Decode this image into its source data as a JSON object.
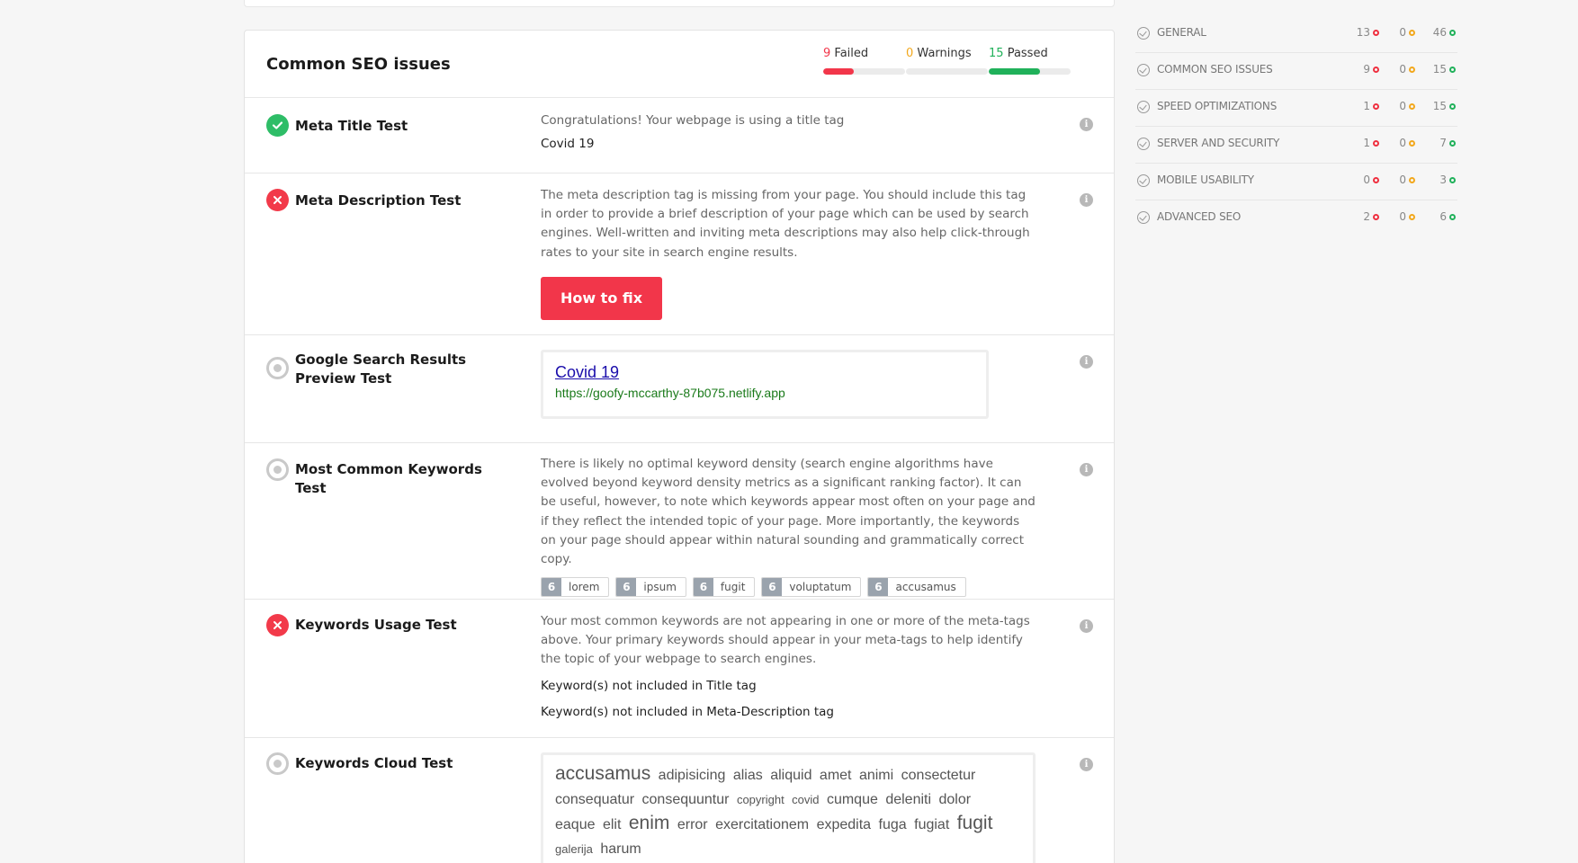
{
  "section": {
    "title": "Common SEO issues",
    "stats": {
      "failed": {
        "count": "9",
        "label": "Failed",
        "fraction": 0.375,
        "color": "#f2364a"
      },
      "warnings": {
        "count": "0",
        "label": "Warnings",
        "fraction": 0,
        "color": "#f2a81d"
      },
      "passed": {
        "count": "15",
        "label": "Passed",
        "fraction": 0.625,
        "color": "#20b15a"
      }
    }
  },
  "tests": {
    "meta_title": {
      "name": "Meta Title Test",
      "status": "pass",
      "description": "Congratulations! Your webpage is using a title tag",
      "value": "Covid 19"
    },
    "meta_description": {
      "name": "Meta Description Test",
      "status": "fail",
      "description": "The meta description tag is missing from your page. You should include this tag in order to provide a brief description of your page which can be used by search engines. Well-written and inviting meta descriptions may also help click-through rates to your site in search engine results.",
      "button": "How to fix"
    },
    "google_preview": {
      "name": "Google Search Results Preview Test",
      "status": "info",
      "serp_title": "Covid 19",
      "serp_url": "https://goofy-mccarthy-87b075.netlify.app"
    },
    "common_keywords": {
      "name": "Most Common Keywords Test",
      "status": "info",
      "description": "There is likely no optimal keyword density (search engine algorithms have evolved beyond keyword density metrics as a significant ranking factor). It can be useful, however, to note which keywords appear most often on your page and if they reflect the intended topic of your page. More importantly, the keywords on your page should appear within natural sounding and grammatically correct copy.",
      "keywords": [
        {
          "count": "6",
          "word": "lorem"
        },
        {
          "count": "6",
          "word": "ipsum"
        },
        {
          "count": "6",
          "word": "fugit"
        },
        {
          "count": "6",
          "word": "voluptatum"
        },
        {
          "count": "6",
          "word": "accusamus"
        }
      ]
    },
    "keywords_usage": {
      "name": "Keywords Usage Test",
      "status": "fail",
      "description": "Your most common keywords are not appearing in one or more of the meta-tags above. Your primary keywords should appear in your meta-tags to help identify the topic of your webpage to search engines.",
      "line1": "Keyword(s) not included in Title tag",
      "line2": "Keyword(s) not included in Meta-Description tag"
    },
    "keywords_cloud": {
      "name": "Keywords Cloud Test",
      "status": "info",
      "words": [
        {
          "word": "accusamus",
          "weight": 3
        },
        {
          "word": "adipisicing",
          "weight": 2
        },
        {
          "word": "alias",
          "weight": 2
        },
        {
          "word": "aliquid",
          "weight": 2
        },
        {
          "word": "amet",
          "weight": 2
        },
        {
          "word": "animi",
          "weight": 2
        },
        {
          "word": "consectetur",
          "weight": 2
        },
        {
          "word": "consequatur",
          "weight": 2
        },
        {
          "word": "consequuntur",
          "weight": 2
        },
        {
          "word": "copyright",
          "weight": 1
        },
        {
          "word": "covid",
          "weight": 1
        },
        {
          "word": "cumque",
          "weight": 2
        },
        {
          "word": "deleniti",
          "weight": 2
        },
        {
          "word": "dolor",
          "weight": 2
        },
        {
          "word": "eaque",
          "weight": 2
        },
        {
          "word": "elit",
          "weight": 2
        },
        {
          "word": "enim",
          "weight": 3
        },
        {
          "word": "error",
          "weight": 2
        },
        {
          "word": "exercitationem",
          "weight": 2
        },
        {
          "word": "expedita",
          "weight": 2
        },
        {
          "word": "fuga",
          "weight": 2
        },
        {
          "word": "fugiat",
          "weight": 2
        },
        {
          "word": "fugit",
          "weight": 3
        },
        {
          "word": "galerija",
          "weight": 1
        },
        {
          "word": "harum",
          "weight": 2
        }
      ]
    }
  },
  "sidebar": {
    "categories": [
      {
        "label": "GENERAL",
        "failed": "13",
        "warnings": "0",
        "passed": "46"
      },
      {
        "label": "COMMON SEO ISSUES",
        "failed": "9",
        "warnings": "0",
        "passed": "15"
      },
      {
        "label": "SPEED OPTIMIZATIONS",
        "failed": "1",
        "warnings": "0",
        "passed": "15"
      },
      {
        "label": "SERVER AND SECURITY",
        "failed": "1",
        "warnings": "0",
        "passed": "7"
      },
      {
        "label": "MOBILE USABILITY",
        "failed": "0",
        "warnings": "0",
        "passed": "3"
      },
      {
        "label": "ADVANCED SEO",
        "failed": "2",
        "warnings": "0",
        "passed": "6"
      }
    ]
  },
  "icons": {
    "pass": "check-icon",
    "fail": "x-icon",
    "info": "radio-icon",
    "help": "info-icon"
  }
}
